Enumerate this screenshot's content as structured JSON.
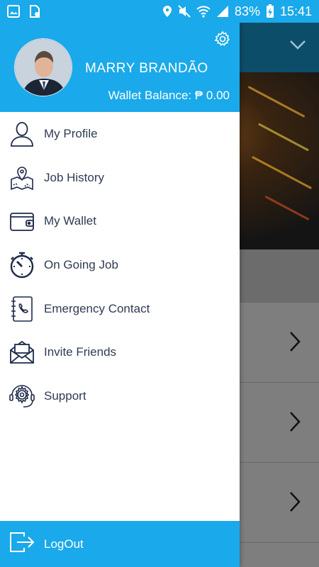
{
  "status_bar": {
    "battery": "83%",
    "time": "15:41"
  },
  "drawer": {
    "user_name": "MARRY BRANDÃO",
    "wallet_balance": "Wallet Balance: ₱ 0.00",
    "menu": [
      {
        "label": "My Profile",
        "icon": "profile-icon"
      },
      {
        "label": "Job History",
        "icon": "map-icon"
      },
      {
        "label": "My Wallet",
        "icon": "wallet-icon"
      },
      {
        "label": "On Going Job",
        "icon": "stopwatch-icon"
      },
      {
        "label": "Emergency Contact",
        "icon": "contact-book-icon"
      },
      {
        "label": "Invite Friends",
        "icon": "envelope-icon"
      },
      {
        "label": "Support",
        "icon": "support-icon"
      }
    ],
    "logout_label": "LogOut"
  },
  "colors": {
    "accent": "#1aa9ea",
    "text": "#2f3b52",
    "icon": "#1e2a4a"
  }
}
